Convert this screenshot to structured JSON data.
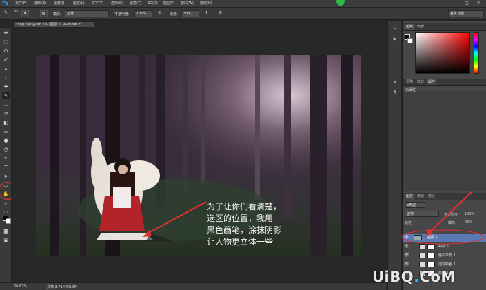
{
  "app": {
    "logo": "Ps"
  },
  "menu": [
    "文件(F)",
    "编辑(E)",
    "图像(I)",
    "图层(L)",
    "文字(Y)",
    "选择(S)",
    "滤镜(T)",
    "3D(D)",
    "视图(V)",
    "窗口(W)",
    "帮助(H)"
  ],
  "window_controls": {
    "minimize": "—",
    "restore": "□",
    "close": "✕"
  },
  "options_bar": {
    "brush_size": "35",
    "mode_label": "模式:",
    "mode_value": "正常",
    "opacity_label": "不透明度:",
    "opacity_value": "100%",
    "flow_label": "流量:",
    "flow_value": "30%",
    "workspace": "基本功能"
  },
  "document_tab": "bing.psd @ 66.7% (图层 1, RGB/8#) *",
  "canvas_text": [
    "为了让你们看清楚，",
    "选区的位置，我用",
    "黑色画笔，涂抹阴影",
    "让人物更立体一些"
  ],
  "status": {
    "zoom": "66.67%",
    "doc": "文档:3.71M/58.3M"
  },
  "panels": {
    "color_tabs": [
      "颜色",
      "色板"
    ],
    "adjust_tabs": [
      "调整",
      "样式",
      "属性"
    ],
    "properties_text": "无属性",
    "layers_tabs": [
      "图层",
      "通道",
      "路径"
    ],
    "filter_kind": "ρ类型",
    "blend_mode": "正常",
    "opacity_label": "不透明度:",
    "opacity_value": "100%",
    "lock_label": "锁定:",
    "fill_label": "填充:",
    "fill_value": "45%",
    "layers": [
      {
        "name": "图层 1",
        "selected": true
      },
      {
        "name": "曲线 3",
        "selected": false
      },
      {
        "name": "色彩平衡 1",
        "selected": false
      },
      {
        "name": "选取颜色 1",
        "selected": false
      },
      {
        "name": "曲线 1",
        "selected": false
      }
    ]
  },
  "tool_icons": [
    "move-icon",
    "marquee-icon",
    "lasso-icon",
    "quick-select-icon",
    "crop-icon",
    "eyedropper-icon",
    "healing-icon",
    "brush-icon",
    "clone-stamp-icon",
    "history-brush-icon",
    "eraser-icon",
    "gradient-icon",
    "blur-icon",
    "dodge-icon",
    "pen-icon",
    "type-icon",
    "path-select-icon",
    "shape-icon",
    "hand-icon",
    "zoom-icon"
  ],
  "watermark": {
    "part1": "UiBQ",
    "dot": ".",
    "part2": "CoM"
  },
  "colors": {
    "accent_red": "#e03030",
    "selection_blue": "#5a7ab5",
    "watermark_blue": "#29b6f6"
  }
}
